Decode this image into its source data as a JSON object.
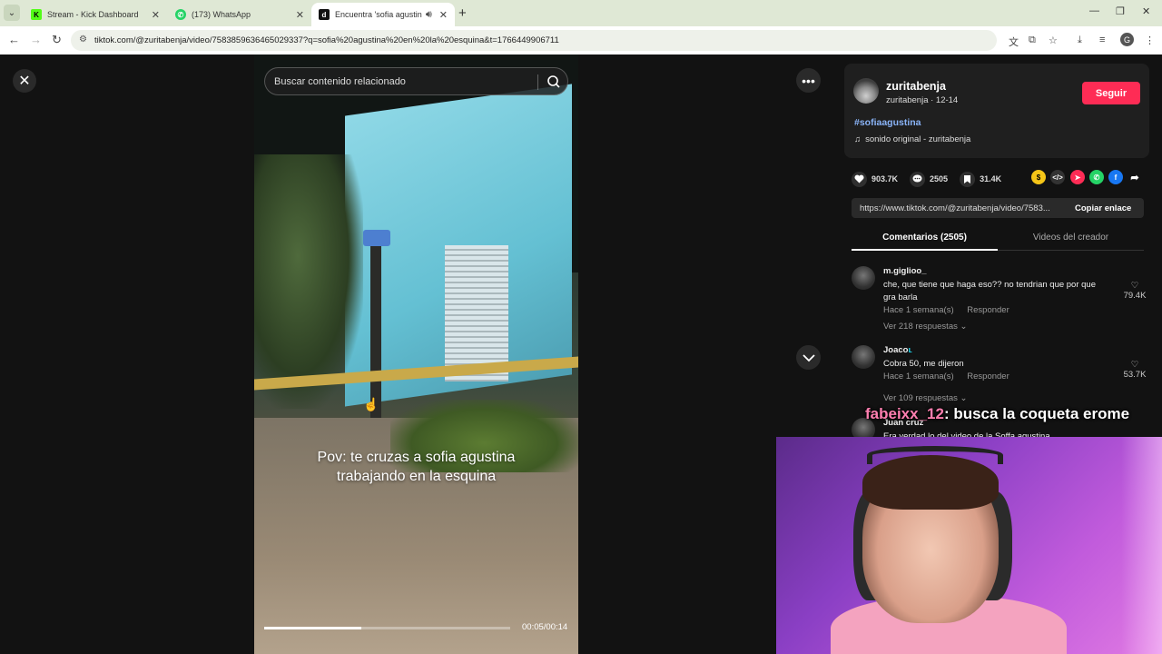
{
  "browser": {
    "tabs": [
      {
        "title": "Stream - Kick Dashboard",
        "fav_color": "#53fc18",
        "fav_text": "K"
      },
      {
        "title": "(173) WhatsApp",
        "fav_color": "#25d366",
        "fav_text": "✆"
      },
      {
        "title": "Encuentra 'sofia agustina e",
        "fav_color": "#111111",
        "fav_text": "d"
      }
    ],
    "url": "tiktok.com/@zuritabenja/video/7583859636465029337?q=sofia%20agustina%20en%20la%20esquina&t=1766449906711",
    "profile_initial": "G"
  },
  "video": {
    "search_placeholder": "Buscar contenido relacionado",
    "caption": "Pov: te cruzas a sofia agustina trabajando en la esquina",
    "progress": 0.395,
    "time": "00:05/00:14"
  },
  "author": {
    "name": "zuritabenja",
    "handle_date": "zuritabenja · 12-14",
    "follow_label": "Seguir",
    "hashtag": "#sofiaagustina",
    "sound": "sonido original - zuritabenja"
  },
  "stats": {
    "likes": "903.7K",
    "comments": "2505",
    "saves": "31.4K"
  },
  "link": {
    "url": "https://www.tiktok.com/@zuritabenja/video/7583...",
    "copy_label": "Copiar enlace"
  },
  "tabs": {
    "comments": "Comentarios (2505)",
    "creator_videos": "Videos del creador"
  },
  "comments": [
    {
      "user": "m.giglioo_",
      "text": "che, que tiene que haga eso?? no tendrian que por que gra barla",
      "time": "Hace 1 semana(s)",
      "reply": "Responder",
      "replies": "Ver 218 respuestas",
      "likes": "79.4K"
    },
    {
      "user": "Joaco",
      "text": "Cobra 50, me dijeron",
      "time": "Hace 1 semana(s)",
      "reply": "Responder",
      "replies": "Ver 109 respuestas",
      "likes": "53.7K"
    },
    {
      "user": "Juan cruz",
      "text": "Era verdad lo del video de la Soffa agustina"
    }
  ],
  "chat_overlay": {
    "user": "fabeixx_12",
    "message": ": busca la coqueta erome"
  },
  "colors": {
    "follow": "#fe2c55",
    "hashtag": "#8ab4f8"
  }
}
